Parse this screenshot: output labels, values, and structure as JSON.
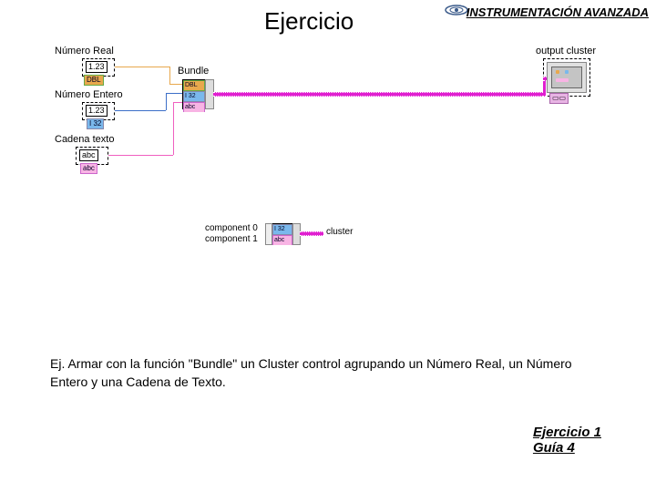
{
  "header": {
    "title": "Ejercicio",
    "subtitle": "INSTRUMENTACIÓN AVANZADA"
  },
  "diagram": {
    "labels": {
      "numero_real": "Número Real",
      "numero_entero": "Número Entero",
      "cadena_texto": "Cadena texto",
      "bundle": "Bundle",
      "output_cluster": "output cluster",
      "component0": "component 0",
      "component1": "component 1",
      "cluster": "cluster"
    },
    "values": {
      "real_val": "1.23",
      "entero_val": "1.23",
      "abc_val": "abc"
    },
    "types": {
      "dbl": "DBL",
      "i32": "I 32",
      "abc": "abc"
    }
  },
  "instruction": "Ej. Armar con la función \"Bundle\" un Cluster control agrupando un Número Real, un Número Entero y una Cadena de Texto.",
  "footer": {
    "line1": "Ejercicio 1",
    "line2": "Guía 4"
  }
}
